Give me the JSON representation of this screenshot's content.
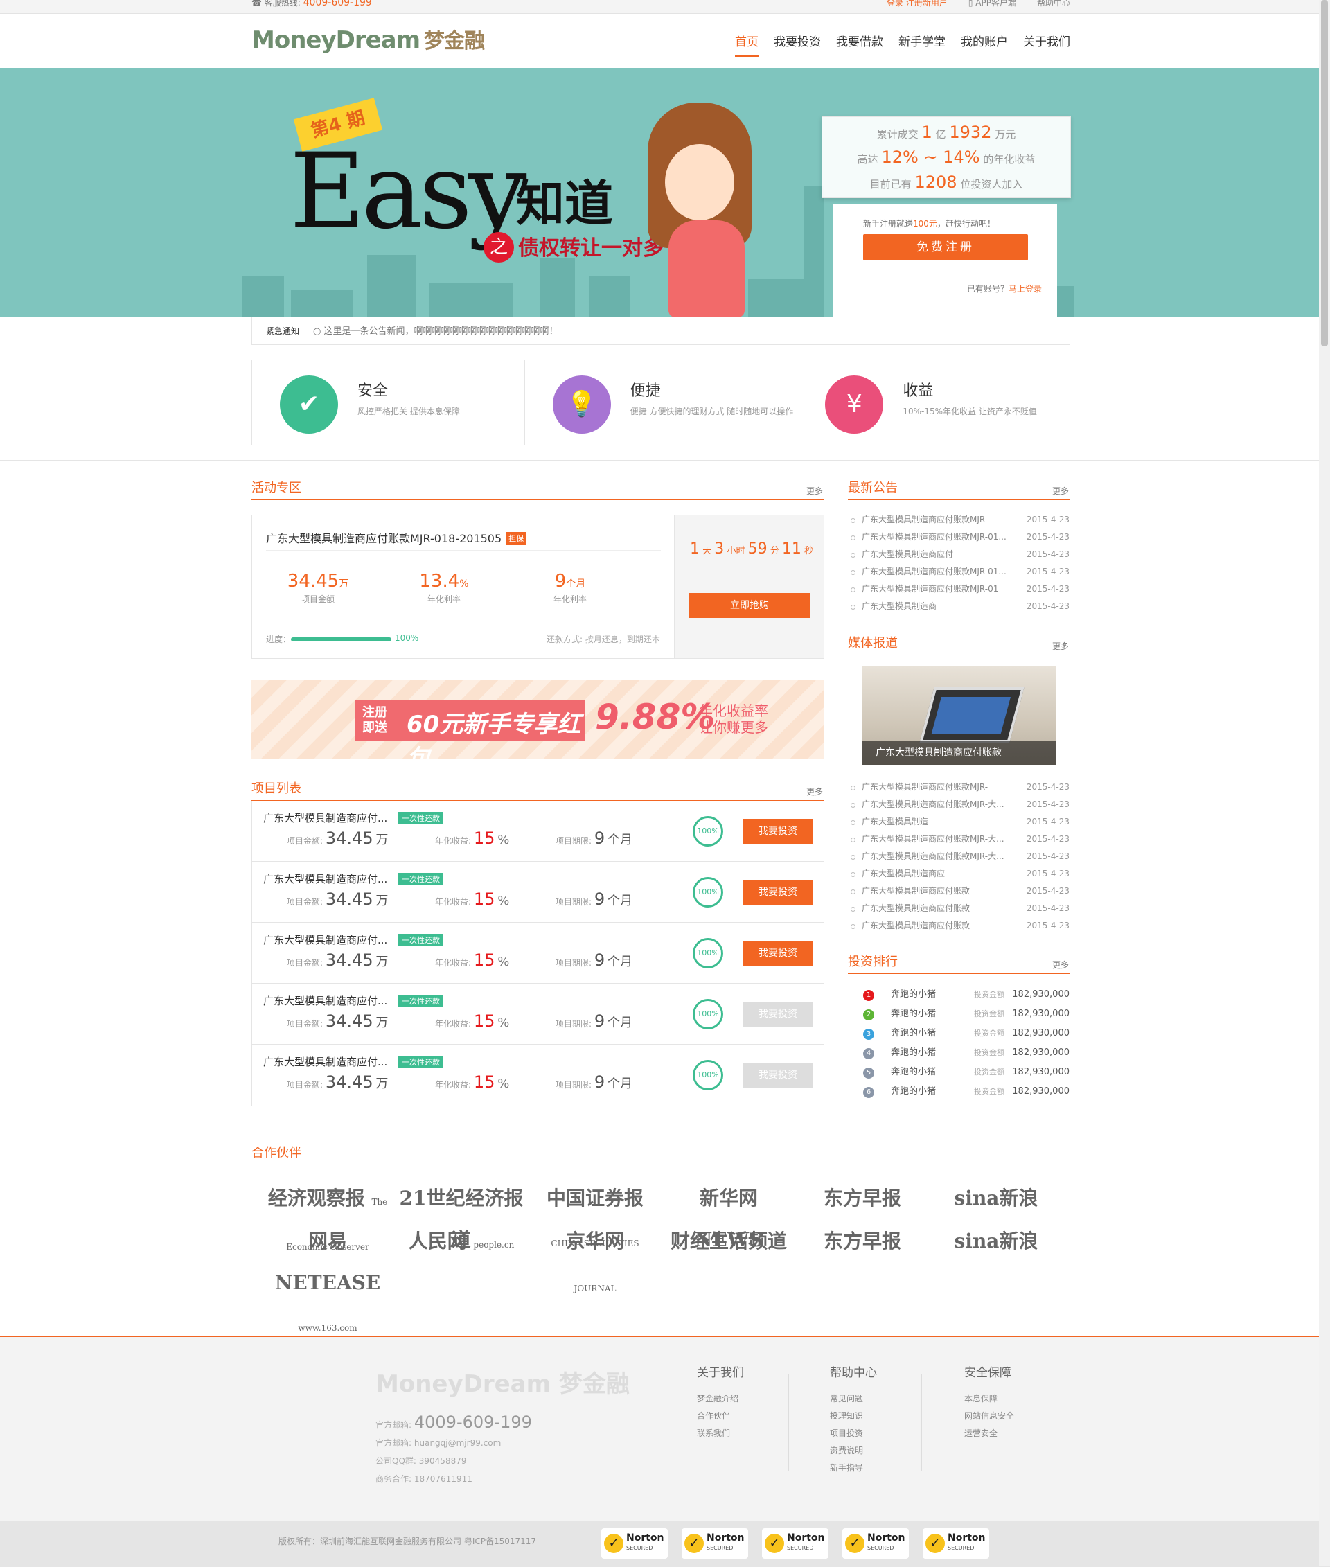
{
  "topbar": {
    "hotline_label": "客服热线:",
    "hotline": "4009-609-199",
    "login": "登录",
    "register": "注册新用户",
    "app": "APP客户端",
    "help": "帮助中心"
  },
  "header": {
    "logo": "MoneyDream",
    "logo_cn": "梦金融",
    "nav": [
      "首页",
      "我要投资",
      "我要借款",
      "新手学堂",
      "我的账户",
      "关于我们"
    ]
  },
  "banner": {
    "issue": "第4 期",
    "title_en": "Easy",
    "title_cn": "知道",
    "zhi": "之",
    "subtitle": "债权转让一对多"
  },
  "stats": {
    "l1_pre": "累计成交",
    "l1_a": "1",
    "l1_b": "亿",
    "l1_c": "1932",
    "l1_d": "万元",
    "l2_pre": "高达",
    "l2_v": "12% ~ 14%",
    "l2_post": "的年化收益",
    "l3_pre": "目前已有",
    "l3_v": "1208",
    "l3_post": "位投资人加入"
  },
  "register": {
    "tip_pre": "新手注册就送",
    "tip_amt": "100元",
    "tip_post": "，赶快行动吧！",
    "button": "免费注册",
    "has_account": "已有账号？",
    "login_now": "马上登录"
  },
  "notice": {
    "label": "紧急通知",
    "text": "○ 这里是一条公告新闻，啊啊啊啊啊啊啊啊啊啊啊啊啊啊啊！"
  },
  "features": [
    {
      "title": "安全",
      "desc": "风控严格把关 提供本息保障",
      "icon": "shield-icon",
      "color": "#3dbd91"
    },
    {
      "title": "便捷",
      "desc": "便捷 方便快捷的理财方式 随时随地可以操作",
      "icon": "bulb-icon",
      "color": "#a774d3"
    },
    {
      "title": "收益",
      "desc": "10%-15%年化收益 让资产永不贬值",
      "icon": "money-bag-icon",
      "color": "#ea4f7a"
    }
  ],
  "activity": {
    "head": "活动专区",
    "more": "更多",
    "name": "广东大型模具制造商应付账款MJR-018-201505",
    "tag": "担保",
    "amount": "34.45",
    "amount_unit": "万",
    "amount_label": "项目金额",
    "rate": "13.4",
    "rate_unit": "%",
    "rate_label": "年化利率",
    "term": "9",
    "term_unit": "个月",
    "term_label": "年化利率",
    "progress_label": "进度：",
    "progress": "100%",
    "progress_value": 1.0,
    "repay": "还款方式: 按月还息，到期还本",
    "cd": [
      "1",
      "天",
      "3",
      "小时",
      "59",
      "分",
      "11",
      "秒"
    ],
    "buy": "立即抢购"
  },
  "promo": {
    "a": "注册\n即送",
    "b": "60元新手专享红包",
    "rate": "9.88%",
    "t1": "年化收益率",
    "t2": "让你赚更多"
  },
  "projects": {
    "head": "项目列表",
    "more": "更多",
    "rows": [
      {
        "name": "广东大型模具制造商应付...",
        "tag": "一次性还款",
        "amount_label": "项目金额:",
        "amount": "34.45",
        "amount_unit": "万",
        "rate_label": "年化收益:",
        "rate": "15",
        "rate_unit": "%",
        "term_label": "项目期限:",
        "term": "9",
        "term_unit": "个月",
        "pct": "100%",
        "btn": "我要投资",
        "active": true
      },
      {
        "name": "广东大型模具制造商应付...",
        "tag": "一次性还款",
        "amount_label": "项目金额:",
        "amount": "34.45",
        "amount_unit": "万",
        "rate_label": "年化收益:",
        "rate": "15",
        "rate_unit": "%",
        "term_label": "项目期限:",
        "term": "9",
        "term_unit": "个月",
        "pct": "100%",
        "btn": "我要投资",
        "active": true
      },
      {
        "name": "广东大型模具制造商应付...",
        "tag": "一次性还款",
        "amount_label": "项目金额:",
        "amount": "34.45",
        "amount_unit": "万",
        "rate_label": "年化收益:",
        "rate": "15",
        "rate_unit": "%",
        "term_label": "项目期限:",
        "term": "9",
        "term_unit": "个月",
        "pct": "100%",
        "btn": "我要投资",
        "active": true
      },
      {
        "name": "广东大型模具制造商应付...",
        "tag": "一次性还款",
        "amount_label": "项目金额:",
        "amount": "34.45",
        "amount_unit": "万",
        "rate_label": "年化收益:",
        "rate": "15",
        "rate_unit": "%",
        "term_label": "项目期限:",
        "term": "9",
        "term_unit": "个月",
        "pct": "100%",
        "btn": "我要投资",
        "active": false
      },
      {
        "name": "广东大型模具制造商应付...",
        "tag": "一次性还款",
        "amount_label": "项目金额:",
        "amount": "34.45",
        "amount_unit": "万",
        "rate_label": "年化收益:",
        "rate": "15",
        "rate_unit": "%",
        "term_label": "项目期限:",
        "term": "9",
        "term_unit": "个月",
        "pct": "100%",
        "btn": "我要投资",
        "active": false
      }
    ]
  },
  "announcements": {
    "head": "最新公告",
    "more": "更多",
    "items": [
      {
        "t": "广东大型模具制造商应付账款MJR-",
        "d": "2015-4-23"
      },
      {
        "t": "广东大型模具制造商应付账款MJR-01...",
        "d": "2015-4-23"
      },
      {
        "t": "广东大型模具制造商应付",
        "d": "2015-4-23"
      },
      {
        "t": "广东大型模具制造商应付账款MJR-01...",
        "d": "2015-4-23"
      },
      {
        "t": "广东大型模具制造商应付账款MJR-01",
        "d": "2015-4-23"
      },
      {
        "t": "广东大型模具制造商",
        "d": "2015-4-23"
      }
    ]
  },
  "media": {
    "head": "媒体报道",
    "more": "更多",
    "caption": "广东大型模具制造商应付账款",
    "items": [
      {
        "t": "广东大型模具制造商应付账款MJR-",
        "d": "2015-4-23"
      },
      {
        "t": "广东大型模具制造商应付账款MJR-大...",
        "d": "2015-4-23"
      },
      {
        "t": "广东大型模具制造",
        "d": "2015-4-23"
      },
      {
        "t": "广东大型模具制造商应付账款MJR-大...",
        "d": "2015-4-23"
      },
      {
        "t": "广东大型模具制造商应付账款MJR-大...",
        "d": "2015-4-23"
      },
      {
        "t": "广东大型模具制造商应",
        "d": "2015-4-23"
      },
      {
        "t": "广东大型模具制造商应付账款",
        "d": "2015-4-23"
      },
      {
        "t": "广东大型模具制造商应付账款",
        "d": "2015-4-23"
      },
      {
        "t": "广东大型模具制造商应付账款",
        "d": "2015-4-23"
      }
    ]
  },
  "ranking": {
    "head": "投资排行",
    "more": "更多",
    "items": [
      {
        "no": "1",
        "name": "奔跑的小猪",
        "label": "投资金额",
        "value": "182,930,000",
        "color": "#e5191c"
      },
      {
        "no": "2",
        "name": "奔跑的小猪",
        "label": "投资金额",
        "value": "182,930,000",
        "color": "#5db535"
      },
      {
        "no": "3",
        "name": "奔跑的小猪",
        "label": "投资金额",
        "value": "182,930,000",
        "color": "#3aa2dd"
      },
      {
        "no": "4",
        "name": "奔跑的小猪",
        "label": "投资金额",
        "value": "182,930,000",
        "color": "#8a96a8"
      },
      {
        "no": "5",
        "name": "奔跑的小猪",
        "label": "投资金额",
        "value": "182,930,000",
        "color": "#8a96a8"
      },
      {
        "no": "6",
        "name": "奔跑的小猪",
        "label": "投资金额",
        "value": "182,930,000",
        "color": "#8a96a8"
      }
    ]
  },
  "partners": {
    "head": "合作伙伴",
    "logos": [
      [
        "经济观察报",
        "The Economic Observer"
      ],
      [
        "21世纪经济报道",
        ""
      ],
      [
        "中国证券报",
        "CHINA SECURITIES JOURNAL"
      ],
      [
        "新华网 NEWS",
        ""
      ],
      [
        "东方早报",
        ""
      ],
      [
        "sina新浪",
        ""
      ],
      [
        "网易 NETEASE",
        "www.163.com"
      ],
      [
        "人民网",
        "people.cn"
      ],
      [
        "京华网",
        ""
      ],
      [
        "财经生活频道",
        ""
      ],
      [
        "东方早报",
        ""
      ],
      [
        "sina新浪",
        ""
      ]
    ]
  },
  "footer": {
    "logo": "MoneyDream 梦金融",
    "phone_label": "官方邮箱:",
    "phone": "4009-609-199",
    "email_label": "官方邮箱:",
    "email": "huangqj@mjr99.com",
    "qq_label": "公司QQ群:",
    "qq": "390458879",
    "biz_label": "商务合作:",
    "biz": "18707611911",
    "cols": [
      {
        "title": "关于我们",
        "items": [
          "梦金融介绍",
          "合作伙伴",
          "联系我们"
        ]
      },
      {
        "title": "帮助中心",
        "items": [
          "常见问题",
          "投理知识",
          "项目投资",
          "资费说明",
          "新手指导"
        ]
      },
      {
        "title": "安全保障",
        "items": [
          "本息保障",
          "网站信息安全",
          "运营安全"
        ]
      }
    ],
    "copyright": "版权所有：深圳前海汇能互联网金融服务有限公司 粤ICP备15017117",
    "norton": "Norton",
    "norton_sub": "SECURED"
  }
}
